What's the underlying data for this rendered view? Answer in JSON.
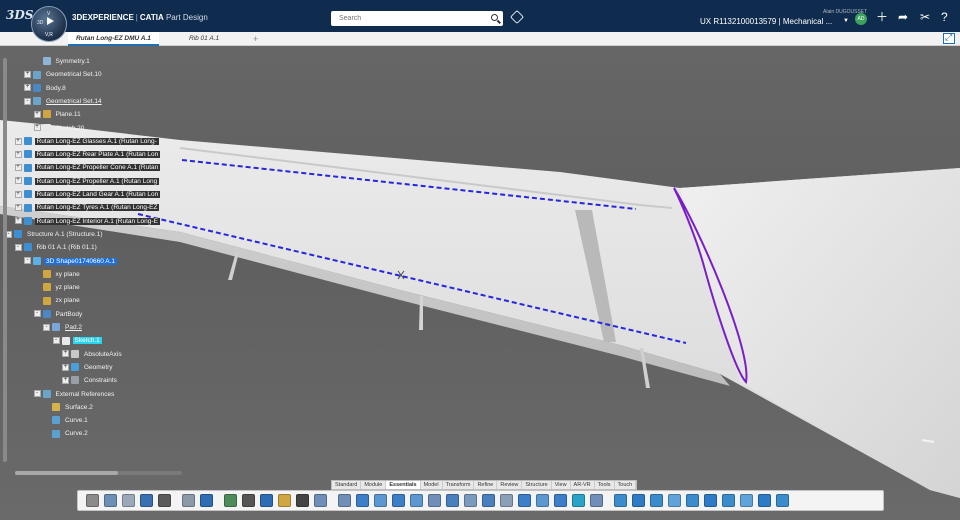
{
  "topbar": {
    "brand_logo": "3DS",
    "compass": {
      "n": "3D",
      "e": "V",
      "version": "V,R"
    },
    "title_brand": "3DEXPERIENCE",
    "title_product": "CATIA",
    "title_app": "Part Design",
    "search_placeholder": "Search",
    "user_name": "Alain DUGOUSSET",
    "context": "UX R1132100013579 | Mechanical ...",
    "avatar_initials": "AD",
    "icons": [
      "plus-icon",
      "share-icon",
      "tools-icon",
      "help-icon"
    ]
  },
  "tabs": [
    {
      "label": "Rutan Long-EZ DMU A.1",
      "active": true
    },
    {
      "label": "Rib 01 A.1",
      "active": false
    }
  ],
  "tree": [
    {
      "label": "Symmetry.1",
      "level": 4,
      "style": "normal",
      "icon": "symmetry-icon"
    },
    {
      "label": "Geometrical Set.10",
      "level": 3,
      "style": "normal",
      "icon": "geoset-icon",
      "expander": "+"
    },
    {
      "label": "Body.8",
      "level": 3,
      "style": "normal",
      "icon": "body-icon",
      "expander": "+"
    },
    {
      "label": "Geometrical Set.14",
      "level": 3,
      "style": "underline",
      "icon": "geoset-icon",
      "expander": "-"
    },
    {
      "label": "Plane.11",
      "level": 4,
      "style": "normal",
      "icon": "plane-icon",
      "expander": "+"
    },
    {
      "label": "Sketch.20",
      "level": 4,
      "style": "normal",
      "icon": "sketch-icon",
      "expander": "+"
    },
    {
      "label": "Rutan Long-EZ Glasses A.1 (Rutan Long-",
      "level": 2,
      "style": "product",
      "icon": "product-icon",
      "expander": "+"
    },
    {
      "label": "Rutan Long-EZ Rear Plate A.1 (Rutan Lon",
      "level": 2,
      "style": "product",
      "icon": "product-icon",
      "expander": "+"
    },
    {
      "label": "Rutan Long-EZ Propeller Cone A.1 (Rutan",
      "level": 2,
      "style": "product",
      "icon": "product-icon",
      "expander": "+"
    },
    {
      "label": "Rutan Long-EZ Propeller A.1 (Rutan Long",
      "level": 2,
      "style": "product",
      "icon": "product-icon",
      "expander": "+"
    },
    {
      "label": "Rutan Long-EZ Land Gear A.1 (Rutan Lon",
      "level": 2,
      "style": "product",
      "icon": "product-icon",
      "expander": "+"
    },
    {
      "label": "Rutan Long-EZ Tyres A.1 (Rutan Long-EZ",
      "level": 2,
      "style": "product",
      "icon": "product-icon",
      "expander": "+"
    },
    {
      "label": "Rutan Long-EZ Interior A.1 (Rutan Long-E",
      "level": 2,
      "style": "product",
      "icon": "product-icon",
      "expander": "+"
    },
    {
      "label": "Structure A.1 (Structure.1)",
      "level": 1,
      "style": "normal",
      "icon": "product-icon",
      "expander": "-"
    },
    {
      "label": "Rib 01 A.1 (Rib 01.1)",
      "level": 2,
      "style": "normal",
      "icon": "product-icon",
      "expander": "-"
    },
    {
      "label": "3D Shape01740660 A.1",
      "level": 3,
      "style": "selected",
      "icon": "part-icon",
      "expander": "-"
    },
    {
      "label": "xy plane",
      "level": 4,
      "style": "normal",
      "icon": "plane-icon"
    },
    {
      "label": "yz plane",
      "level": 4,
      "style": "normal",
      "icon": "plane-icon"
    },
    {
      "label": "zx plane",
      "level": 4,
      "style": "normal",
      "icon": "plane-icon"
    },
    {
      "label": "PartBody",
      "level": 4,
      "style": "normal",
      "icon": "body-icon",
      "expander": "-"
    },
    {
      "label": "Pad.2",
      "level": 5,
      "style": "underline",
      "icon": "pad-icon",
      "expander": "-"
    },
    {
      "label": "Sketch.1",
      "level": 6,
      "style": "highlight",
      "icon": "sketch-icon",
      "expander": "-"
    },
    {
      "label": "AbsoluteAxis",
      "level": 7,
      "style": "normal",
      "icon": "axis-icon",
      "expander": "+"
    },
    {
      "label": "Geometry",
      "level": 7,
      "style": "normal",
      "icon": "geometry-icon",
      "expander": "+"
    },
    {
      "label": "Constraints",
      "level": 7,
      "style": "normal",
      "icon": "constraints-icon",
      "expander": "+"
    },
    {
      "label": "External References",
      "level": 4,
      "style": "normal",
      "icon": "geoset-icon",
      "expander": "-"
    },
    {
      "label": "Surface.2",
      "level": 5,
      "style": "normal",
      "icon": "surface-icon"
    },
    {
      "label": "Curve.1",
      "level": 5,
      "style": "normal",
      "icon": "curve-icon"
    },
    {
      "label": "Curve.2",
      "level": 5,
      "style": "normal",
      "icon": "curve-icon"
    }
  ],
  "section_tabs": [
    {
      "label": "Standard",
      "active": false
    },
    {
      "label": "Module",
      "active": false
    },
    {
      "label": "Essentials",
      "active": true
    },
    {
      "label": "Model",
      "active": false
    },
    {
      "label": "Transform",
      "active": false
    },
    {
      "label": "Refine",
      "active": false
    },
    {
      "label": "Review",
      "active": false
    },
    {
      "label": "Structure",
      "active": false
    },
    {
      "label": "View",
      "active": false
    },
    {
      "label": "AR-VR",
      "active": false
    },
    {
      "label": "Tools",
      "active": false
    },
    {
      "label": "Touch",
      "active": false
    }
  ],
  "actions": [
    {
      "name": "cut-icon",
      "color": "#8b8b8b"
    },
    {
      "name": "copy-icon",
      "color": "#6d8fb5"
    },
    {
      "name": "paste-icon",
      "color": "#9aa8b8"
    },
    {
      "name": "undo-icon",
      "color": "#3a6fb0"
    },
    {
      "name": "zoom-icon",
      "color": "#5b5b5b"
    },
    {
      "name": "update-icon",
      "color": "#8c9aa8"
    },
    {
      "name": "sketch-icon",
      "color": "#2e6db4"
    },
    {
      "name": "sketch-settings-icon",
      "color": "#4e8a5a"
    },
    {
      "name": "point-icon",
      "color": "#555555"
    },
    {
      "name": "line-icon",
      "color": "#2e6db4"
    },
    {
      "name": "plane-icon",
      "color": "#d0a640"
    },
    {
      "name": "axis-system-icon",
      "color": "#444444"
    },
    {
      "name": "pad-icon",
      "color": "#6f8fb8"
    },
    {
      "name": "pocket-icon",
      "color": "#6f8fb8"
    },
    {
      "name": "shaft-icon",
      "color": "#3c7ec8"
    },
    {
      "name": "groove-icon",
      "color": "#5d97cf"
    },
    {
      "name": "rib-icon",
      "color": "#3c7ec8"
    },
    {
      "name": "slot-icon",
      "color": "#5d97cf"
    },
    {
      "name": "hole-icon",
      "color": "#6f8fb8"
    },
    {
      "name": "fillet-icon",
      "color": "#4a7fbd"
    },
    {
      "name": "chamfer-icon",
      "color": "#7c99be"
    },
    {
      "name": "draft-icon",
      "color": "#4a7fbd"
    },
    {
      "name": "shell-icon",
      "color": "#8b9fb6"
    },
    {
      "name": "thickness-icon",
      "color": "#3c7ec8"
    },
    {
      "name": "pattern-icon",
      "color": "#5d97cf"
    },
    {
      "name": "mirror-icon",
      "color": "#3c7ec8"
    },
    {
      "name": "boolean-icon",
      "color": "#2aa3c9"
    },
    {
      "name": "split-icon",
      "color": "#6f8fb8"
    },
    {
      "name": "measure-icon",
      "color": "#3b8ccd"
    },
    {
      "name": "section-icon",
      "color": "#2d7bc4"
    },
    {
      "name": "knowledge-icon",
      "color": "#3b8ccd"
    },
    {
      "name": "catalog-icon",
      "color": "#5fa3d8"
    },
    {
      "name": "render-icon",
      "color": "#3b8ccd"
    },
    {
      "name": "publish-icon",
      "color": "#2d7bc4"
    },
    {
      "name": "compare-icon",
      "color": "#3b8ccd"
    },
    {
      "name": "analysis-icon",
      "color": "#5fa3d8"
    },
    {
      "name": "drafting-icon",
      "color": "#2d7bc4"
    },
    {
      "name": "more-icon",
      "color": "#3b8ccd"
    }
  ],
  "colors": {
    "topbar": "#0f2c4e",
    "selection": "#1e6fd6",
    "highlight": "#2ad4ee",
    "wing_surface": "#e6e6e6",
    "guide_curve": "#2626e0",
    "rib_profile": "#7a1fc7"
  }
}
